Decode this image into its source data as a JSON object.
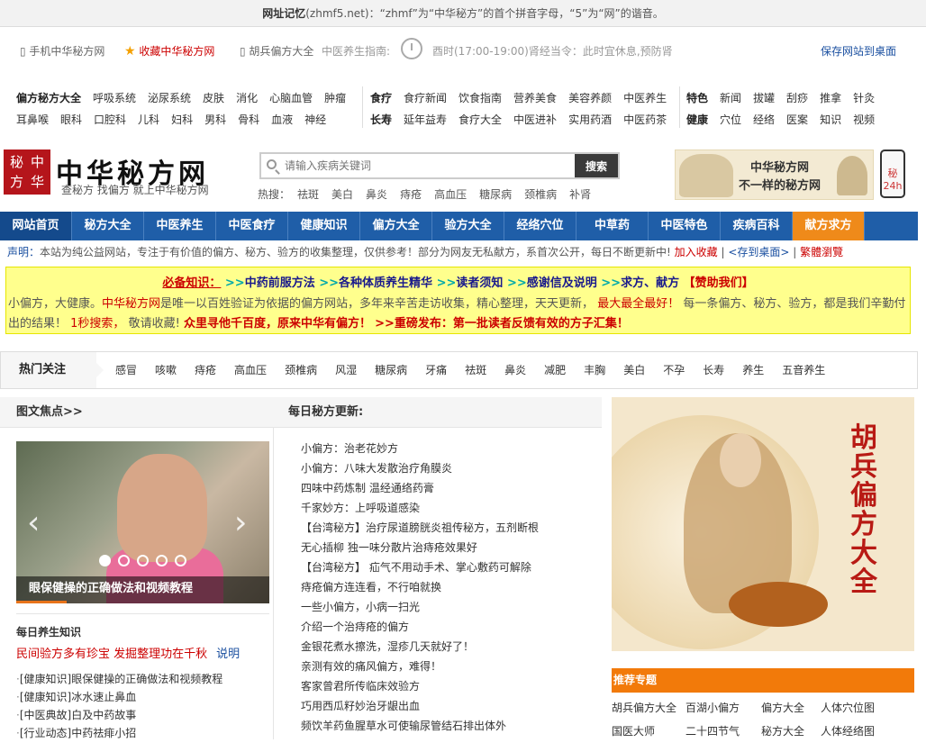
{
  "notice": {
    "bold": "网址记忆",
    "text": "(zhmf5.net)：“zhmf”为“中华秘方”的首个拼音字母，“5”为“网”的谐音。"
  },
  "topbar": {
    "mobile": "手机中华秘方网",
    "favorite": "收藏中华秘方网",
    "hubing": "胡兵偏方大全",
    "guide_label": "中医养生指南:",
    "tip": "酉时(17:00-19:00)肾经当令：此时宜休息,预防肾",
    "save": "保存网站到桌面"
  },
  "links": {
    "row1a": [
      "偏方秘方大全",
      "呼吸系统",
      "泌尿系统",
      "皮肤",
      "消化",
      "心脑血管",
      "肿瘤"
    ],
    "row2a": [
      "耳鼻喉",
      "眼科",
      "口腔科",
      "儿科",
      "妇科",
      "男科",
      "骨科",
      "血液",
      "神经"
    ],
    "row1b": [
      "食疗",
      "食疗新闻",
      "饮食指南",
      "营养美食",
      "美容养颜",
      "中医养生"
    ],
    "row2b": [
      "长寿",
      "延年益寿",
      "食疗大全",
      "中医进补",
      "实用药酒",
      "中医药茶"
    ],
    "row1c": [
      "特色",
      "新闻",
      "拔罐",
      "刮痧",
      "推拿",
      "针灸"
    ],
    "row2c": [
      "健康",
      "穴位",
      "经络",
      "医案",
      "知识",
      "视频"
    ]
  },
  "logo": {
    "seal": [
      "秘",
      "中",
      "方",
      "华"
    ],
    "name": "中华秘方网",
    "slogan": "查秘方 找偏方 就上中华秘方网"
  },
  "search": {
    "placeholder": "请输入疾病关键词",
    "button": "搜索"
  },
  "hot_search": {
    "label": "热搜：",
    "items": [
      "祛斑",
      "美白",
      "鼻炎",
      "痔疮",
      "高血压",
      "糖尿病",
      "颈椎病",
      "补肾"
    ]
  },
  "ad": {
    "line1": "中华秘方网",
    "line2": "不一样的秘方网",
    "phone": "秘 24h"
  },
  "nav": [
    "网站首页",
    "秘方大全",
    "中医养生",
    "中医食疗",
    "健康知识",
    "偏方大全",
    "验方大全",
    "经络穴位",
    "中草药",
    "中医特色",
    "疾病百科",
    "献方求方"
  ],
  "declaration": {
    "label": "声明：",
    "text": "本站为纯公益网站，专注于有价值的偏方、秘方、验方的收集整理，仅供参考！部分为网友无私献方，系首次公开，每日不断更新中!",
    "add_fav": "加入收藏",
    "save_desktop": "<存到桌面>",
    "trad": "繁體瀏覽"
  },
  "notice_box": {
    "must": "必备知识：",
    "links": [
      "中药前服方法",
      "各种体质养生精华",
      "读者须知",
      "感谢信及说明",
      "求方、献方"
    ],
    "donate": "【赞助我们】",
    "p1": "小偏方，大健康。",
    "p2": "中华秘方网",
    "p3": "是唯一以百姓验证为依据的偏方网站，多年来辛苦走访收集，精心整理，天天更新，",
    "p4": "最大最全最好！",
    "p5": "每一条偏方、秘方、验方，都是我们辛勤付出的结果！",
    "p6": "1秒搜索，",
    "p7": "敬请收藏!",
    "p8": "众里寻他千百度，原来中华有偏方！",
    "p9": ">>重磅发布：第一批读者反馈有效的方子汇集！"
  },
  "hot_focus": {
    "label": "热门关注",
    "tags": [
      "感冒",
      "咳嗽",
      "痔疮",
      "高血压",
      "颈椎病",
      "风湿",
      "糖尿病",
      "牙痛",
      "祛斑",
      "鼻炎",
      "减肥",
      "丰胸",
      "美白",
      "不孕",
      "长寿",
      "养生",
      "五音养生"
    ]
  },
  "focus": {
    "title": "图文焦点>>",
    "caption": "眼保健操的正确做法和视频教程",
    "sub": "每日养生知识",
    "red": "民间验方多有珍宝 发掘整理功在千秋",
    "explain": "说明",
    "list": [
      {
        "cat": "[健康知识]",
        "title": "眼保健操的正确做法和视频教程"
      },
      {
        "cat": "[健康知识]",
        "title": "冰水速止鼻血"
      },
      {
        "cat": "[中医典故]",
        "title": "白及中药故事"
      },
      {
        "cat": "[行业动态]",
        "title": "中药祛痱小招"
      }
    ]
  },
  "daily": {
    "title": "每日秘方更新:",
    "items": [
      "小偏方：治老花妙方",
      "小偏方：八味大发散治疗角膜炎",
      "四味中药炼制 温经通络药膏",
      "千家妙方：上呼吸道感染",
      "【台湾秘方】治疗尿道膀胱炎祖传秘方，五剂断根",
      "无心插柳 独一味分散片治痔疮效果好",
      "【台湾秘方】 疝气不用动手术、掌心敷药可解除",
      "痔疮偏方连连看，不行咱就换",
      "一些小偏方，小病一扫光",
      "介绍一个治痔疮的偏方",
      "金银花煮水擦洗，湿疹几天就好了！",
      "亲测有效的痛风偏方，难得！",
      "客家曾君所传临床效验方",
      "巧用西瓜籽妙治牙龈出血",
      "频饮羊药鱼腥草水可使输尿管结石排出体外"
    ]
  },
  "poster": {
    "chars": [
      "胡",
      "兵",
      "偏",
      "方",
      "大",
      "全"
    ]
  },
  "recommend": {
    "title": "推荐专题",
    "items": [
      "胡兵偏方大全",
      "百湖小偏方",
      "偏方大全",
      "人体穴位图",
      "国医大师",
      "二十四节气",
      "秘方大全",
      "人体经络图"
    ]
  }
}
